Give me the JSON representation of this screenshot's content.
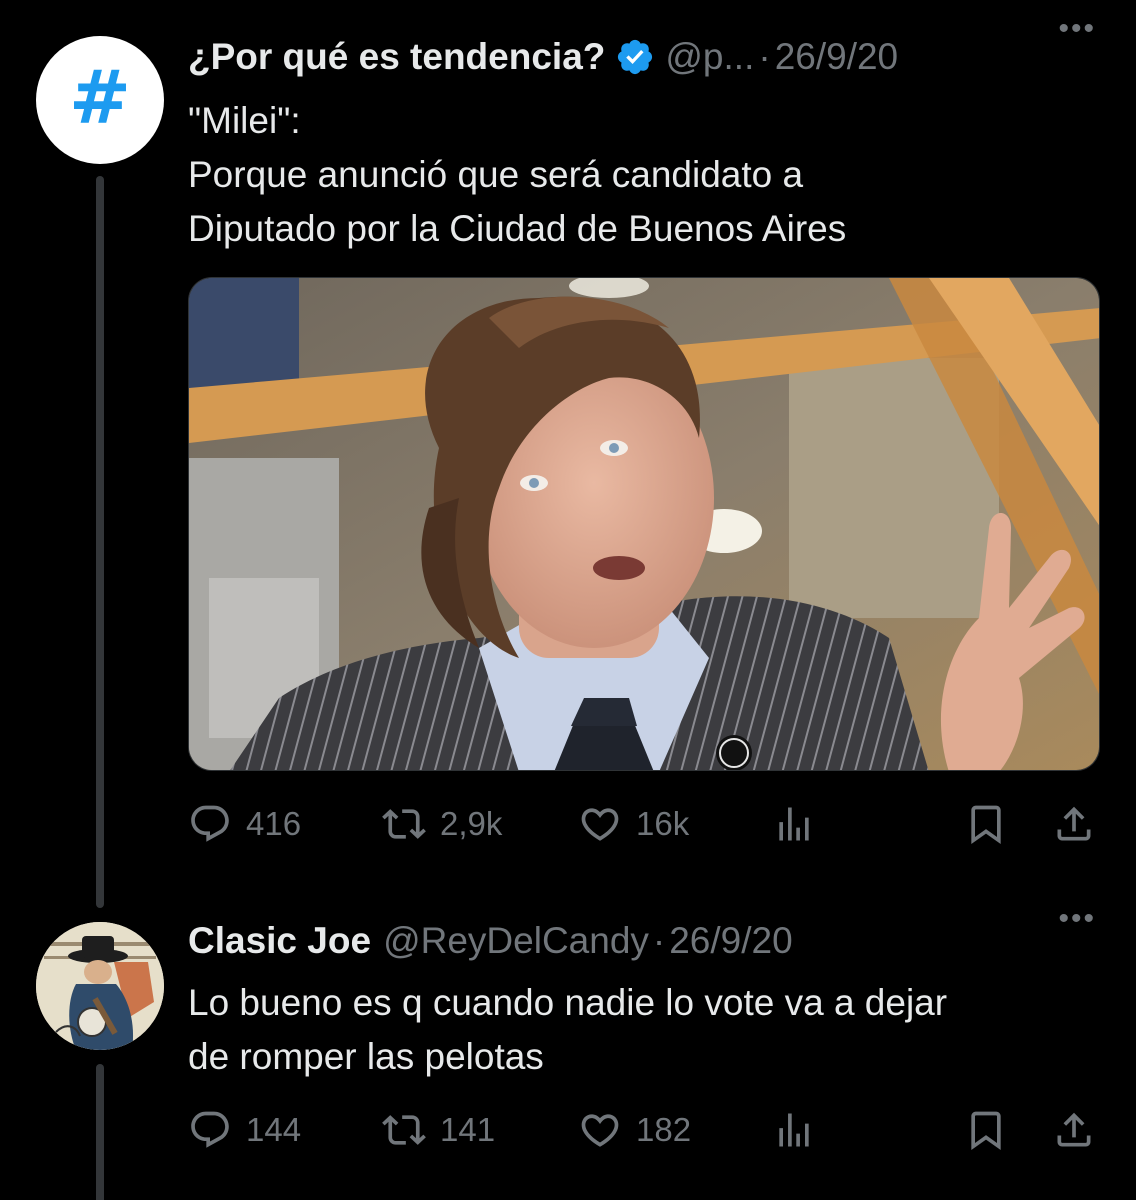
{
  "tweets": [
    {
      "author_name": "¿Por qué es tendencia?",
      "handle": "@p...",
      "date": "26/9/20",
      "avatar_symbol": "#",
      "verified": true,
      "more": "•••",
      "body": [
        "\"Milei\":",
        "Porque anunció que será candidato a",
        "Diputado por la Ciudad de Buenos Aires"
      ],
      "media": "photo of a man with shaggy hair in a pinstriped suit gesturing while speaking",
      "stats": {
        "replies": "416",
        "retweets": "2,9k",
        "likes": "16k"
      }
    },
    {
      "author_name": "Clasic Joe",
      "handle": "@ReyDelCandy",
      "date": "26/9/20",
      "more": "•••",
      "body": [
        "Lo bueno es q cuando nadie lo vote va a dejar",
        "de romper las pelotas"
      ],
      "stats": {
        "replies": "144",
        "retweets": "141",
        "likes": "182"
      }
    }
  ],
  "icons": [
    "reply-icon",
    "retweet-icon",
    "like-icon",
    "views-icon",
    "bookmark-icon",
    "share-icon",
    "verified-badge-icon",
    "more-icon"
  ],
  "colors": {
    "background": "#000000",
    "text": "#e7e9ea",
    "muted": "#71767b",
    "accent": "#1d9bf0"
  }
}
